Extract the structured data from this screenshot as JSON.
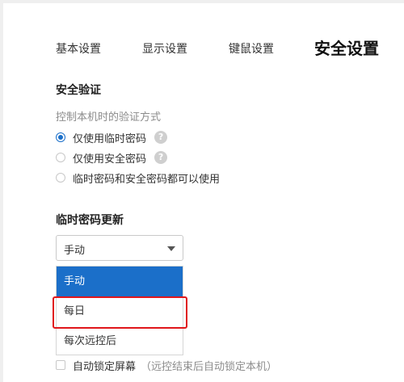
{
  "tabs": [
    {
      "label": "基本设置",
      "active": false
    },
    {
      "label": "显示设置",
      "active": false
    },
    {
      "label": "键鼠设置",
      "active": false
    },
    {
      "label": "安全设置",
      "active": true
    }
  ],
  "security_verification": {
    "heading": "安全验证",
    "description": "控制本机时的验证方式",
    "options": [
      {
        "label": "仅使用临时密码",
        "checked": true,
        "has_help": true
      },
      {
        "label": "仅使用安全密码",
        "checked": false,
        "has_help": true
      },
      {
        "label": "临时密码和安全密码都可以使用",
        "checked": false,
        "has_help": false
      }
    ],
    "help_glyph": "?"
  },
  "temp_password_update": {
    "heading": "临时密码更新",
    "selected_value": "手动",
    "options": [
      "手动",
      "每日",
      "每次远控后"
    ],
    "highlighted_option": "每日"
  },
  "auto_lock": {
    "label": "自动锁定屏幕",
    "note": "（远控结束后自动锁定本机）",
    "checked": false
  },
  "colors": {
    "accent": "#1b6fc9",
    "highlight_border": "#e0161b"
  },
  "icons": {
    "help": "question-circle-icon",
    "dropdown": "caret-down-icon"
  }
}
